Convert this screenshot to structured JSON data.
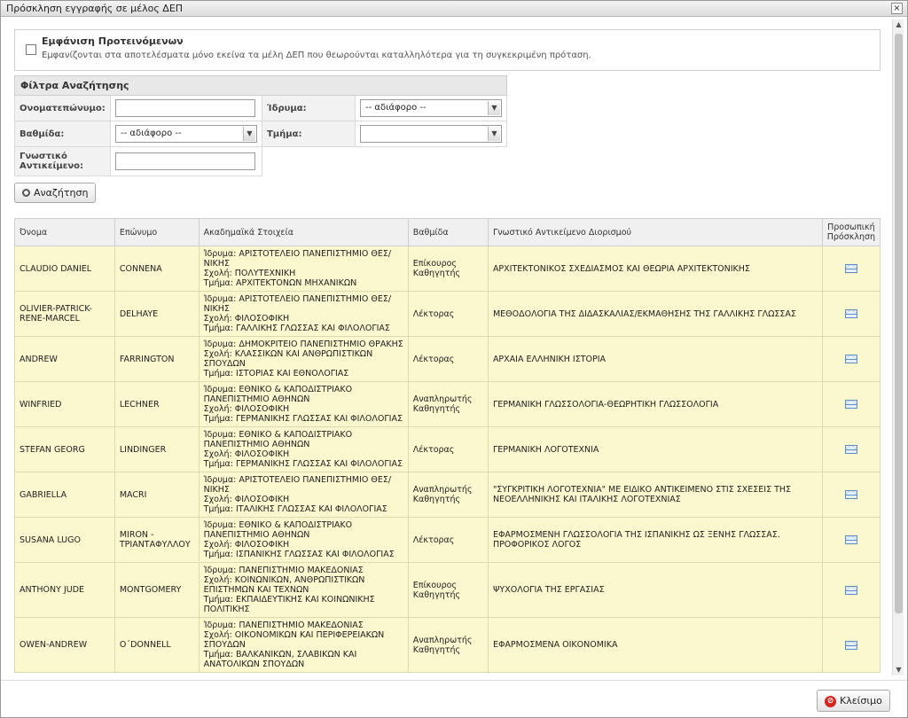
{
  "window": {
    "title": "Πρόσκληση εγγραφής σε μέλος ΔΕΠ",
    "close_glyph": "×"
  },
  "recommended": {
    "label": "Εμφάνιση Προτεινόμενων",
    "description": "Εμφανίζονται στα αποτελέσματα μόνο εκείνα τα μέλη ΔΕΠ που θεωρούνται καταλληλότερα για τη συγκεκριμένη πρόταση."
  },
  "filters": {
    "title": "Φίλτρα Αναζήτησης",
    "name_label": "Ονοματεπώνυμο:",
    "institution_label": "Ίδρυμα:",
    "institution_value": "-- αδιάφορο --",
    "rank_label": "Βαθμίδα:",
    "rank_value": "-- αδιάφορο --",
    "department_label": "Τμήμα:",
    "department_value": "",
    "subject_label": "Γνωστικό Αντικείμενο:",
    "search_button": "Αναζήτηση"
  },
  "table": {
    "headers": {
      "first_name": "Όνομα",
      "last_name": "Επώνυμο",
      "academic": "Ακαδημαϊκά Στοιχεία",
      "rank": "Βαθμίδα",
      "subject": "Γνωστικό Αντικείμενο Διορισμού",
      "invite": "Προσωπική Πρόσκληση"
    },
    "rows": [
      {
        "first": "CLAUDIO DANIEL",
        "last": "CONNENA",
        "a1": "Ίδρυμα: ΑΡΙΣΤΟΤΕΛΕΙΟ ΠΑΝΕΠΙΣΤΗΜΙΟ ΘΕΣ/",
        "a2": "ΝΙΚΗΣ",
        "a3": "Σχολή: ΠΟΛΥΤΕΧΝΙΚΗ",
        "a4": "Τμήμα: ΑΡΧΙΤΕΚΤΟΝΩΝ ΜΗΧΑΝΙΚΩΝ",
        "rank": "Επίκουρος Καθηγητής",
        "subject": "ΑΡΧΙΤΕΚΤΟΝΙΚΟΣ ΣΧΕΔΙΑΣΜΟΣ ΚΑΙ ΘΕΩΡΙΑ ΑΡΧΙΤΕΚΤΟΝΙΚΗΣ"
      },
      {
        "first": "OLIVIER-PATRICK-RENE-MARCEL",
        "last": "DELHAYE",
        "a1": "Ίδρυμα: ΑΡΙΣΤΟΤΕΛΕΙΟ ΠΑΝΕΠΙΣΤΗΜΙΟ ΘΕΣ/",
        "a2": "ΝΙΚΗΣ",
        "a3": "Σχολή: ΦΙΛΟΣΟΦΙΚΗ",
        "a4": "Τμήμα: ΓΑΛΛΙΚΗΣ ΓΛΩΣΣΑΣ ΚΑΙ ΦΙΛΟΛΟΓΙΑΣ",
        "rank": "Λέκτορας",
        "subject": "ΜΕΘΟΔΟΛΟΓΙΑ ΤΗΣ ΔΙΔΑΣΚΑΛΙΑΣ/ΕΚΜΑΘΗΣΗΣ ΤΗΣ ΓΑΛΛΙΚΗΣ ΓΛΩΣΣΑΣ"
      },
      {
        "first": "ANDREW",
        "last": "FARRINGTON",
        "a1": "Ίδρυμα: ΔΗΜΟΚΡΙΤΕΙΟ ΠΑΝΕΠΙΣΤΗΜΙΟ ΘΡΑΚΗΣ",
        "a2": "Σχολή: ΚΛΑΣΣΙΚΩΝ ΚΑΙ ΑΝΘΡΩΠΙΣΤΙΚΩΝ",
        "a3": "ΣΠΟΥΔΩΝ",
        "a4": "Τμήμα: ΙΣΤΟΡΙΑΣ ΚΑΙ ΕΘΝΟΛΟΓΙΑΣ",
        "rank": "Λέκτορας",
        "subject": "ΑΡΧΑΙΑ ΕΛΛΗΝΙΚΗ ΙΣΤΟΡΙΑ"
      },
      {
        "first": "WINFRIED",
        "last": "LECHNER",
        "a1": "Ίδρυμα: ΕΘΝΙΚΟ & ΚΑΠΟΔΙΣΤΡΙΑΚΟ",
        "a2": "ΠΑΝΕΠΙΣΤΗΜΙΟ ΑΘΗΝΩΝ",
        "a3": "Σχολή: ΦΙΛΟΣΟΦΙΚΗ",
        "a4": "Τμήμα: ΓΕΡΜΑΝΙΚΗΣ ΓΛΩΣΣΑΣ ΚΑΙ ΦΙΛΟΛΟΓΙΑΣ",
        "rank": "Αναπληρωτής Καθηγητής",
        "subject": "ΓΕΡΜΑΝΙΚΗ ΓΛΩΣΣΟΛΟΓΙΑ-ΘΕΩΡΗΤΙΚΗ ΓΛΩΣΣΟΛΟΓΙΑ"
      },
      {
        "first": "STEFAN GEORG",
        "last": "LINDINGER",
        "a1": "Ίδρυμα: ΕΘΝΙΚΟ & ΚΑΠΟΔΙΣΤΡΙΑΚΟ",
        "a2": "ΠΑΝΕΠΙΣΤΗΜΙΟ ΑΘΗΝΩΝ",
        "a3": "Σχολή: ΦΙΛΟΣΟΦΙΚΗ",
        "a4": "Τμήμα: ΓΕΡΜΑΝΙΚΗΣ ΓΛΩΣΣΑΣ ΚΑΙ ΦΙΛΟΛΟΓΙΑΣ",
        "rank": "Λέκτορας",
        "subject": "ΓΕΡΜΑΝΙΚΗ ΛΟΓΟΤΕΧΝΙΑ"
      },
      {
        "first": "GABRIELLA",
        "last": "MACRI",
        "a1": "Ίδρυμα: ΑΡΙΣΤΟΤΕΛΕΙΟ ΠΑΝΕΠΙΣΤΗΜΙΟ ΘΕΣ/",
        "a2": "ΝΙΚΗΣ",
        "a3": "Σχολή: ΦΙΛΟΣΟΦΙΚΗ",
        "a4": "Τμήμα: ΙΤΑΛΙΚΗΣ ΓΛΩΣΣΑΣ ΚΑΙ ΦΙΛΟΛΟΓΙΑΣ",
        "rank": "Αναπληρωτής Καθηγητής",
        "subject": "\"ΣΥΓΚΡΙΤΙΚΗ ΛΟΓΟΤΕΧΝΙΑ\" ΜΕ ΕΙΔΙΚΟ ΑΝΤΙΚΕΙΜΕΝΟ ΣΤΙΣ ΣΧΕΣΕΙΣ ΤΗΣ ΝΕΟΕΛΛΗΝΙΚΗΣ ΚΑΙ ΙΤΑΛΙΚΗΣ ΛΟΓΟΤΕΧΝΙΑΣ"
      },
      {
        "first": "SUSANA LUGO",
        "last": "MIRON - ΤΡΙΑΝΤΑΦΥΛΛΟΥ",
        "a1": "Ίδρυμα: ΕΘΝΙΚΟ & ΚΑΠΟΔΙΣΤΡΙΑΚΟ",
        "a2": "ΠΑΝΕΠΙΣΤΗΜΙΟ ΑΘΗΝΩΝ",
        "a3": "Σχολή: ΦΙΛΟΣΟΦΙΚΗ",
        "a4": "Τμήμα: ΙΣΠΑΝΙΚΗΣ ΓΛΩΣΣΑΣ ΚΑΙ ΦΙΛΟΛΟΓΙΑΣ",
        "rank": "Λέκτορας",
        "subject": "ΕΦΑΡΜΟΣΜΕΝΗ ΓΛΩΣΣΟΛΟΓΙΑ ΤΗΣ ΙΣΠΑΝΙΚΗΣ ΩΣ ΞΕΝΗΣ ΓΛΩΣΣΑΣ. ΠΡΟΦΟΡΙΚΟΣ ΛΟΓΟΣ"
      },
      {
        "first": "ANTHONY JUDE",
        "last": "MONTGOMERY",
        "a1": "Ίδρυμα: ΠΑΝΕΠΙΣΤΗΜΙΟ ΜΑΚΕΔΟΝΙΑΣ",
        "a2": "Σχολή: ΚΟΙΝΩΝΙΚΩΝ, ΑΝΘΡΩΠΙΣΤΙΚΩΝ",
        "a3": "ΕΠΙΣΤΗΜΩΝ ΚΑΙ ΤΕΧΝΩΝ",
        "a4": "Τμήμα: ΕΚΠΑΙΔΕΥΤΙΚΗΣ ΚΑΙ ΚΟΙΝΩΝΙΚΗΣ",
        "a5": "ΠΟΛΙΤΙΚΗΣ",
        "rank": "Επίκουρος Καθηγητής",
        "subject": "ΨΥΧΟΛΟΓΙΑ ΤΗΣ ΕΡΓΑΣΙΑΣ"
      },
      {
        "first": "OWEN-ANDREW",
        "last": "O΄DONNELL",
        "a1": "Ίδρυμα: ΠΑΝΕΠΙΣΤΗΜΙΟ ΜΑΚΕΔΟΝΙΑΣ",
        "a2": "Σχολή: ΟΙΚΟΝΟΜΙΚΩΝ ΚΑΙ ΠΕΡΙΦΕΡΕΙΑΚΩΝ",
        "a3": "ΣΠΟΥΔΩΝ",
        "a4": "Τμήμα: ΒΑΛΚΑΝΙΚΩΝ, ΣΛΑΒΙΚΩΝ ΚΑΙ",
        "a5": "ΑΝΑΤΟΛΙΚΩΝ ΣΠΟΥΔΩΝ",
        "rank": "Αναπληρωτής Καθηγητής",
        "subject": "ΕΦΑΡΜΟΣΜΕΝΑ ΟΙΚΟΝΟΜΙΚΑ"
      }
    ]
  },
  "footer": {
    "close_button": "Κλείσιμο"
  }
}
